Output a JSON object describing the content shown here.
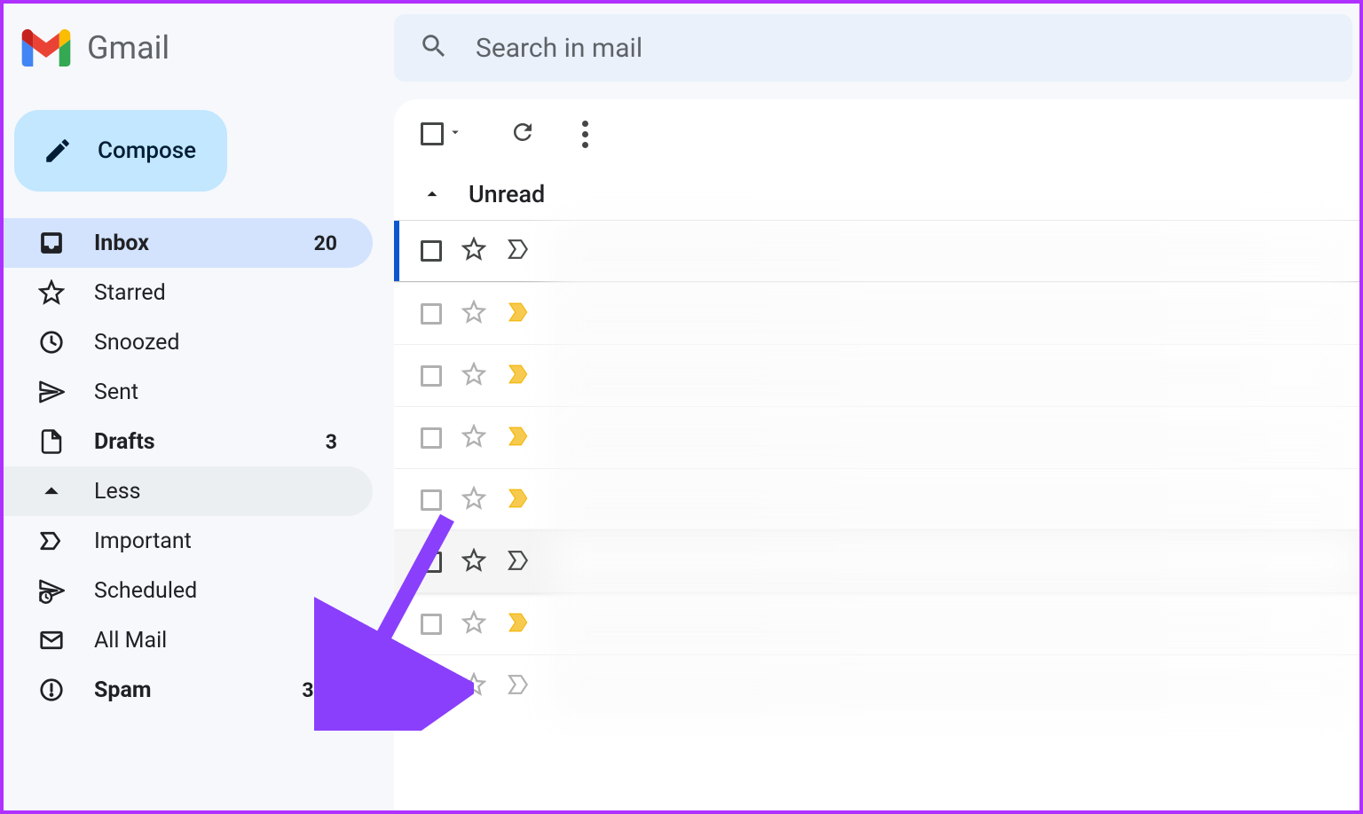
{
  "app": {
    "name": "Gmail"
  },
  "search": {
    "placeholder": "Search in mail"
  },
  "compose": {
    "label": "Compose"
  },
  "sidebar": {
    "items": [
      {
        "key": "inbox",
        "label": "Inbox",
        "count": "20",
        "bold": true,
        "active": true,
        "icon": "inbox"
      },
      {
        "key": "starred",
        "label": "Starred",
        "count": "",
        "bold": false,
        "active": false,
        "icon": "star"
      },
      {
        "key": "snoozed",
        "label": "Snoozed",
        "count": "",
        "bold": false,
        "active": false,
        "icon": "clock"
      },
      {
        "key": "sent",
        "label": "Sent",
        "count": "",
        "bold": false,
        "active": false,
        "icon": "send"
      },
      {
        "key": "drafts",
        "label": "Drafts",
        "count": "3",
        "bold": true,
        "active": false,
        "icon": "draft"
      },
      {
        "key": "less",
        "label": "Less",
        "count": "",
        "bold": false,
        "active": false,
        "icon": "chevron-up",
        "less": true
      },
      {
        "key": "important",
        "label": "Important",
        "count": "",
        "bold": false,
        "active": false,
        "icon": "important"
      },
      {
        "key": "scheduled",
        "label": "Scheduled",
        "count": "",
        "bold": false,
        "active": false,
        "icon": "schedule"
      },
      {
        "key": "allmail",
        "label": "All Mail",
        "count": "",
        "bold": false,
        "active": false,
        "icon": "allmail"
      },
      {
        "key": "spam",
        "label": "Spam",
        "count": "362",
        "bold": true,
        "active": false,
        "icon": "spam"
      }
    ]
  },
  "section": {
    "label": "Unread"
  },
  "rows": [
    {
      "state": "selected",
      "starFilled": false,
      "important": "outline"
    },
    {
      "state": "normal",
      "starFilled": false,
      "important": "gold"
    },
    {
      "state": "normal",
      "starFilled": false,
      "important": "gold"
    },
    {
      "state": "normal",
      "starFilled": false,
      "important": "gold"
    },
    {
      "state": "normal",
      "starFilled": false,
      "important": "gold"
    },
    {
      "state": "hover",
      "starFilled": false,
      "important": "outline"
    },
    {
      "state": "normal",
      "starFilled": false,
      "important": "gold"
    },
    {
      "state": "normal",
      "starFilled": false,
      "important": "outline"
    }
  ]
}
